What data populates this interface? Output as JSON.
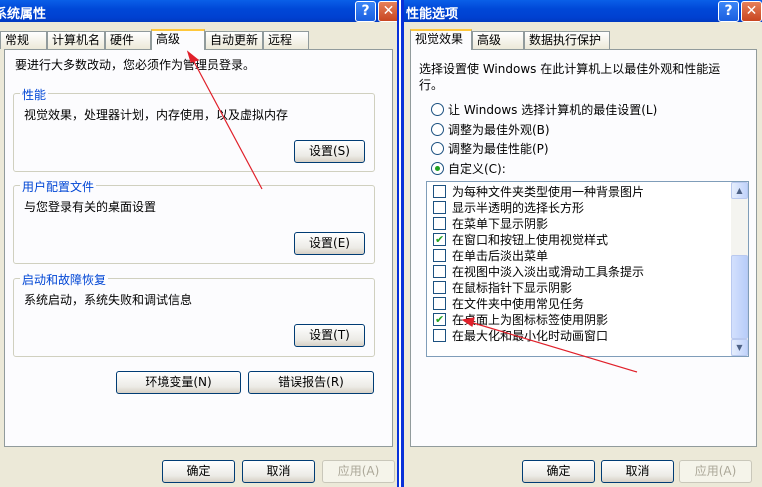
{
  "left_window": {
    "title": "系统属性",
    "help_label": "?",
    "close_label": "✕",
    "tabs": [
      "常规",
      "计算机名",
      "硬件",
      "高级",
      "自动更新",
      "远程"
    ],
    "notice": "要进行大多数改动，您必须作为管理员登录。",
    "groups": [
      {
        "title": "性能",
        "desc": "视觉效果，处理器计划，内存使用，以及虚拟内存",
        "button": "设置(S)"
      },
      {
        "title": "用户配置文件",
        "desc": "与您登录有关的桌面设置",
        "button": "设置(E)"
      },
      {
        "title": "启动和故障恢复",
        "desc": "系统启动，系统失败和调试信息",
        "button": "设置(T)"
      }
    ],
    "env_button": "环境变量(N)",
    "error_button": "错误报告(R)",
    "ok": "确定",
    "cancel": "取消",
    "apply": "应用(A)"
  },
  "right_window": {
    "title": "性能选项",
    "help_label": "?",
    "close_label": "✕",
    "tabs": [
      "视觉效果",
      "高级",
      "数据执行保护"
    ],
    "intro_line1": "选择设置使 Windows 在此计算机上以最佳外观和性能运",
    "intro_line2": "行。",
    "radios": [
      {
        "label": "让 Windows 选择计算机的最佳设置(L)",
        "checked": false
      },
      {
        "label": "调整为最佳外观(B)",
        "checked": false
      },
      {
        "label": "调整为最佳性能(P)",
        "checked": false
      },
      {
        "label": "自定义(C):",
        "checked": true
      }
    ],
    "options": [
      {
        "label": "为每种文件夹类型使用一种背景图片",
        "checked": false
      },
      {
        "label": "显示半透明的选择长方形",
        "checked": false
      },
      {
        "label": "在菜单下显示阴影",
        "checked": false
      },
      {
        "label": "在窗口和按钮上使用视觉样式",
        "checked": true
      },
      {
        "label": "在单击后淡出菜单",
        "checked": false
      },
      {
        "label": "在视图中淡入淡出或滑动工具条提示",
        "checked": false
      },
      {
        "label": "在鼠标指针下显示阴影",
        "checked": false
      },
      {
        "label": "在文件夹中使用常见任务",
        "checked": false
      },
      {
        "label": "在桌面上为图标标签使用阴影",
        "checked": true
      },
      {
        "label": "在最大化和最小化时动画窗口",
        "checked": false
      }
    ],
    "ok": "确定",
    "cancel": "取消",
    "apply": "应用(A)"
  },
  "colors": {
    "title_bar": "#0054e3",
    "annotation_arrow": "#e0202a",
    "group_title": "#0046d5"
  }
}
